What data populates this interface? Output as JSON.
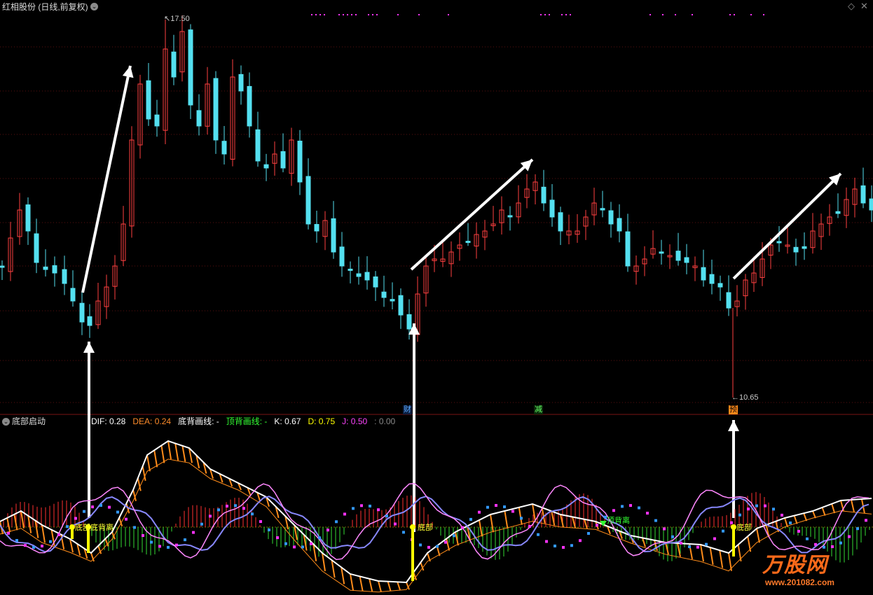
{
  "main_panel": {
    "title": "红相股份 (日线,前复权)",
    "high_label": "17.50",
    "low_label": "10.65",
    "signals": [
      {
        "text": "财",
        "color": "#5aa9ff",
        "bg": "#0c1f40"
      },
      {
        "text": "减",
        "color": "#66ff66",
        "bg": "#0a2a0a"
      },
      {
        "text": "预",
        "color": "#000000",
        "bg": "#ff8a1a"
      }
    ]
  },
  "indicator_panel": {
    "title": "底部启动",
    "readouts": [
      {
        "label": "DIF: ",
        "value": "0.28",
        "color": "#ffffff"
      },
      {
        "label": "DEA: ",
        "value": "0.24",
        "color": "#ff8c2a"
      },
      {
        "label": "底背画线: ",
        "value": "-",
        "color": "#ffffff"
      },
      {
        "label": "顶背画线: ",
        "value": "-",
        "color": "#33ff33"
      },
      {
        "label": "K: ",
        "value": "0.67",
        "color": "#ffffff"
      },
      {
        "label": "D: ",
        "value": "0.75",
        "color": "#ffff00"
      },
      {
        "label": "J: ",
        "value": "0.50",
        "color": "#ff44ff"
      },
      {
        "label": ": ",
        "value": "0.00",
        "color": "#888888"
      }
    ],
    "annotations": [
      "底部底背离",
      "底部",
      "顶背离",
      "底部"
    ]
  },
  "watermark": {
    "brand": "万股网",
    "url": "www.201082.com"
  },
  "colors": {
    "up": "#ff4040",
    "down": "#54e0f0",
    "background": "#000000"
  }
}
